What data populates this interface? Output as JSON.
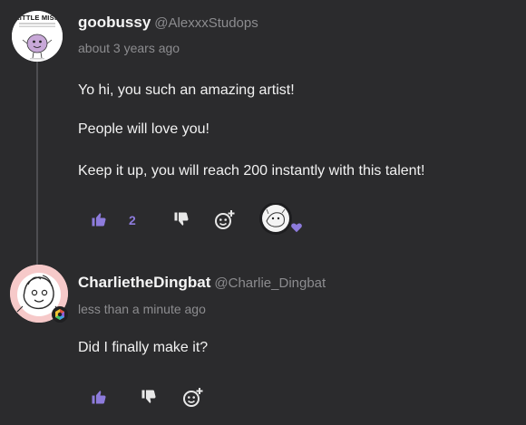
{
  "colors": {
    "background": "#2b2b2d",
    "accent": "#8d7bdc",
    "muted": "#8c8c8f",
    "thread": "#4d4d51"
  },
  "comments": [
    {
      "username": "goobussy",
      "handle": "@AlexxxStudops",
      "timestamp": "about 3 years ago",
      "avatar_text": "LITTLE MISS",
      "avatar_icon": "little-miss-avatar",
      "paragraphs": [
        "Yo hi, you such an amazing artist!",
        "People will love you!",
        "Keep it up, you will reach 200 instantly with this talent!"
      ],
      "actions": {
        "like_icon": "thumbs-up-icon",
        "like_count": "2",
        "dislike_icon": "thumbs-down-icon",
        "react_icon": "add-reaction-icon",
        "reaction_icon": "heart-icon"
      }
    },
    {
      "username": "CharlietheDingbat",
      "handle": "@Charlie_Dingbat",
      "timestamp": "less than a minute ago",
      "avatar_icon": "sketch-avatar",
      "badge_icon": "hexagon-badge-icon",
      "paragraphs": [
        "Did I finally make it?"
      ],
      "actions": {
        "like_icon": "thumbs-up-icon",
        "dislike_icon": "thumbs-down-icon",
        "react_icon": "add-reaction-icon"
      }
    }
  ]
}
